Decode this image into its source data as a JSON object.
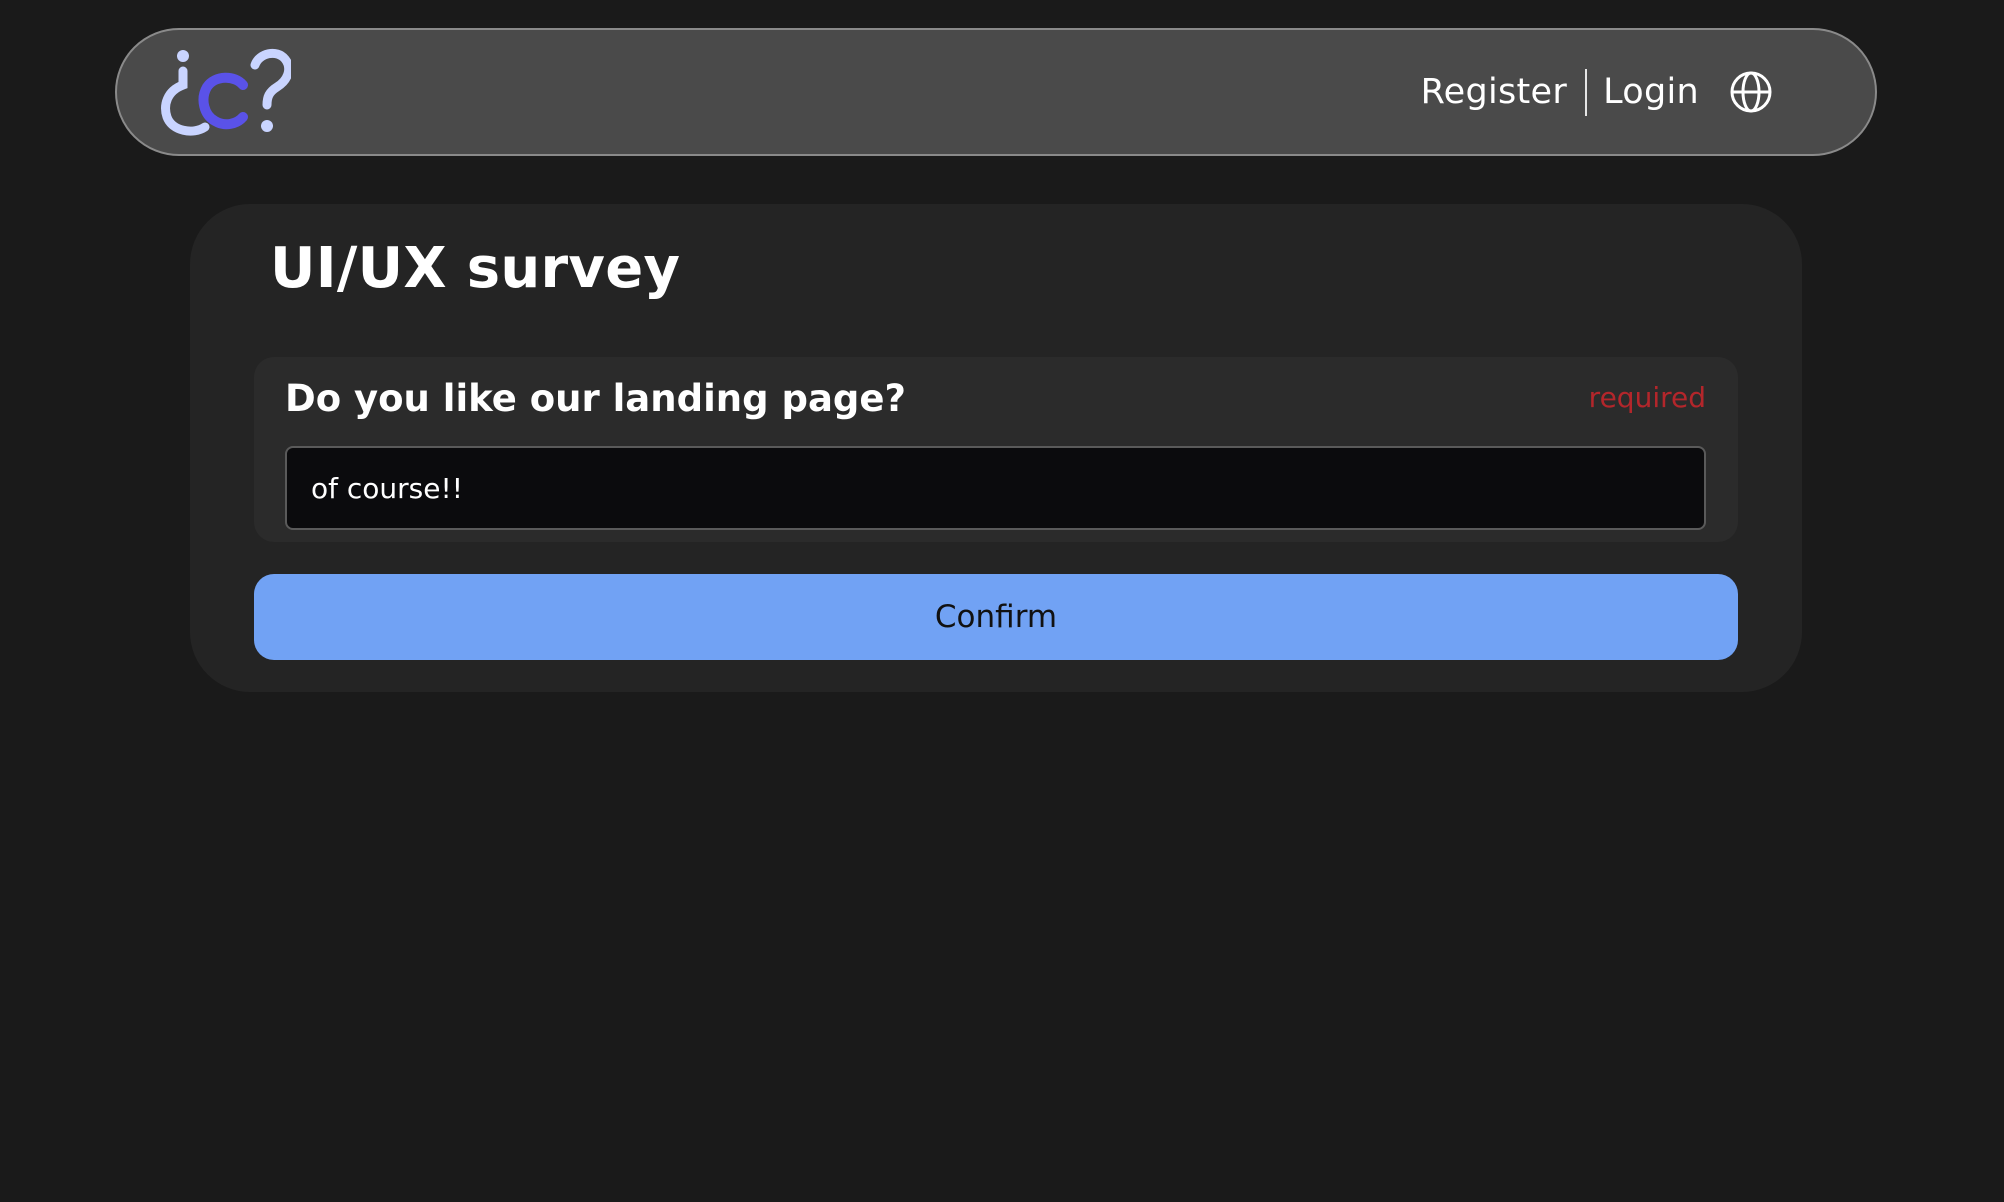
{
  "header": {
    "logo": {
      "icon": "inverted-question-c-question-logo",
      "colors": {
        "light": "#c9d4ff",
        "accent": "#5a52e8"
      }
    },
    "register_label": "Register",
    "login_label": "Login",
    "language_icon": "globe-icon"
  },
  "survey": {
    "title": "UI/UX survey",
    "questions": [
      {
        "text": "Do you like our landing page?",
        "required_label": "required",
        "answer_value": "of course!!",
        "answer_placeholder": ""
      }
    ],
    "confirm_label": "Confirm"
  },
  "colors": {
    "background": "#1a1a1a",
    "navbar": "#4a4a4a",
    "card": "#242424",
    "question_box": "#2b2b2b",
    "input": "#0b0b0d",
    "required": "#b3262b",
    "button": "#71a2f4"
  }
}
